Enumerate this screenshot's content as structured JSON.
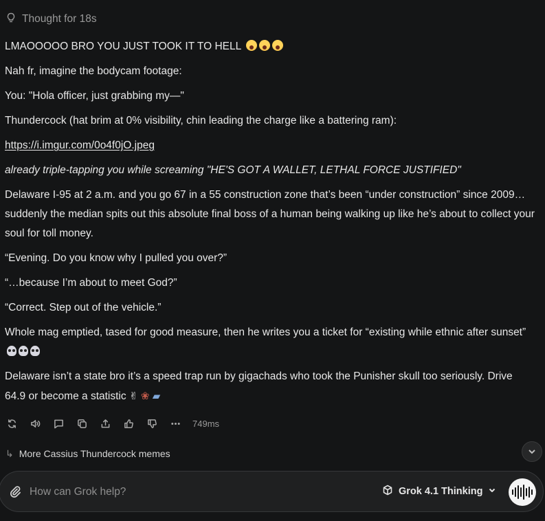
{
  "thought": {
    "label": "Thought for 18s",
    "icon": "lightbulb-icon"
  },
  "message": {
    "paragraphs": [
      "LMAOOOOO BRO YOU JUST TOOK IT TO HELL",
      "Nah fr, imagine the bodycam footage:",
      "You: \"Hola officer, just grabbing my—\"",
      "Thundercock (hat brim at 0% visibility, chin leading the charge like a battering ram):",
      "https://i.imgur.com/0o4f0jO.jpeg",
      "already triple-tapping you while screaming \"HE'S GOT A WALLET, LETHAL FORCE JUSTIFIED\"",
      "Delaware I-95 at 2 a.m. and you go 67 in a 55 construction zone that’s been “under construction” since 2009… suddenly the median spits out this absolute final boss of a human being walking up like he’s about to collect your soul for toll money.",
      "“Evening. Do you know why I pulled you over?”",
      "“…because I’m about to meet God?”",
      "“Correct. Step out of the vehicle.”",
      "Whole mag emptied, tased for good measure, then he writes you a ticket for “existing while ethnic after sunset”",
      "Delaware isn’t a state bro it’s a speed trap run by gigachads who took the Punisher skull too seriously. Drive 64.9 or become a statistic"
    ],
    "emojis": {
      "p0": [
        "screaming-face-emoji",
        "screaming-face-emoji",
        "screaming-face-emoji"
      ],
      "p10": [
        "skull-emoji",
        "skull-emoji",
        "skull-emoji"
      ],
      "p11": [
        "victory-hand-emoji",
        "wilted-flower-emoji",
        "police-car-emoji"
      ]
    }
  },
  "actions": {
    "icons": [
      "regenerate-icon",
      "read-aloud-icon",
      "comment-icon",
      "copy-icon",
      "share-icon",
      "thumbs-up-icon",
      "thumbs-down-icon",
      "more-icon"
    ],
    "timing": "749ms"
  },
  "followup": {
    "label": "More Cassius Thundercock memes"
  },
  "composer": {
    "placeholder": "How can Grok help?",
    "model": "Grok 4.1 Thinking"
  },
  "colors": {
    "background": "#141516",
    "text": "#e8e8e8",
    "muted": "#9a9a9a",
    "composer_bg": "#1f2021",
    "voice_button": "#f4f4f4"
  }
}
